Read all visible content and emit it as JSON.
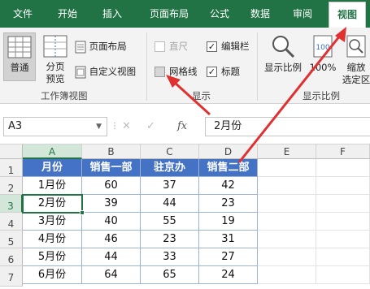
{
  "tabs": [
    {
      "label": "文件",
      "active": false
    },
    {
      "label": "开始",
      "active": false
    },
    {
      "label": "插入",
      "active": false
    },
    {
      "label": "页面布局",
      "active": false
    },
    {
      "label": "公式",
      "active": false
    },
    {
      "label": "数据",
      "active": false
    },
    {
      "label": "审阅",
      "active": false
    },
    {
      "label": "视图",
      "active": true
    }
  ],
  "ribbon": {
    "workbook_views": {
      "normal_label": "普通",
      "page_break_label_1": "分页",
      "page_break_label_2": "预览",
      "page_layout_label": "页面布局",
      "custom_views_label": "自定义视图",
      "group_label": "工作簿视图"
    },
    "show": {
      "ruler_label": "直尺",
      "ruler_checked": false,
      "ruler_enabled": false,
      "formula_bar_label": "编辑栏",
      "formula_bar_checked": true,
      "gridlines_label": "网格线",
      "gridlines_checked": false,
      "headings_label": "标题",
      "headings_checked": true,
      "group_label": "显示"
    },
    "zoom": {
      "zoom_label": "显示比例",
      "hundred_label": "100%",
      "zoom_selection_label_1": "缩放",
      "zoom_selection_label_2": "选定区",
      "group_label": "显示比例"
    }
  },
  "formula_bar": {
    "name_box": "A3",
    "cancel_symbol": "✕",
    "enter_symbol": "✓",
    "fx_symbol": "fx",
    "formula_value": "2月份"
  },
  "sheet": {
    "columns": [
      "A",
      "B",
      "C",
      "D",
      "E",
      "F"
    ],
    "rows": [
      "1",
      "2",
      "3",
      "4",
      "5",
      "6",
      "7"
    ],
    "active_cell": "A3",
    "header_row": [
      "月份",
      "销售一部",
      "驻京办",
      "销售二部"
    ],
    "data_rows": [
      [
        "1月份",
        "60",
        "37",
        "42"
      ],
      [
        "2月份",
        "39",
        "44",
        "23"
      ],
      [
        "3月份",
        "40",
        "55",
        "19"
      ],
      [
        "4月份",
        "46",
        "23",
        "31"
      ],
      [
        "5月份",
        "44",
        "33",
        "27"
      ],
      [
        "6月份",
        "64",
        "65",
        "24"
      ]
    ]
  },
  "colors": {
    "ribbon_green": "#217346",
    "table_header_blue": "#4472c4",
    "annotation_red": "#e03030"
  }
}
